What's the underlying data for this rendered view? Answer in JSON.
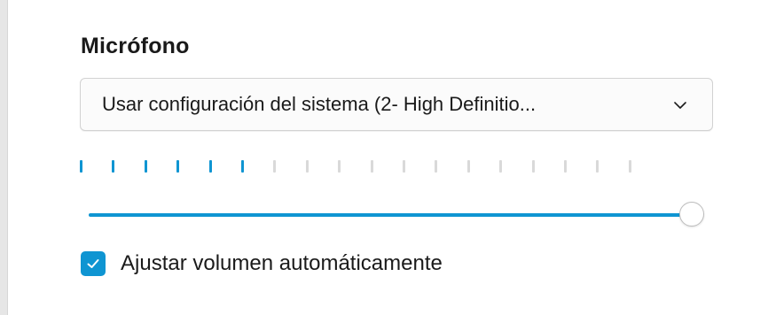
{
  "microphone": {
    "title": "Micrófono",
    "dropdown": {
      "selected_value": "Usar configuración del sistema (2- High Definitio...",
      "icon": "chevron-down-icon"
    },
    "level_meter": {
      "total_ticks": 18,
      "active_ticks": 6
    },
    "volume_slider": {
      "value_fraction": 1.0
    },
    "auto_adjust": {
      "label": "Ajustar volumen automáticamente",
      "checked": true
    }
  },
  "colors": {
    "accent": "#0f95d2",
    "inactive_tick": "#d9d9d9",
    "border": "#d2d2d2",
    "text": "#1a1a1a"
  }
}
